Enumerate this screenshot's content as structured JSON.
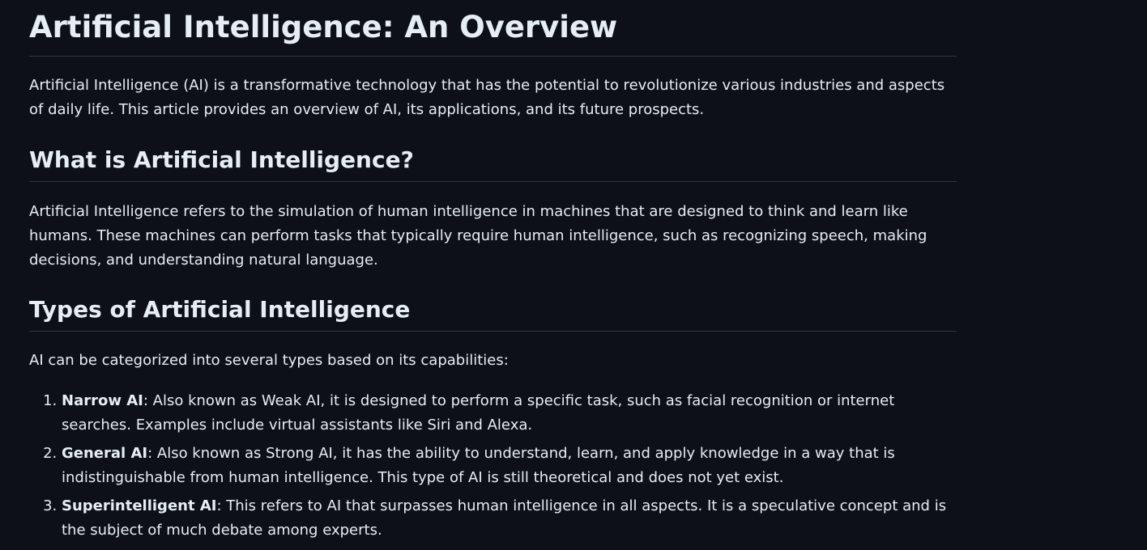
{
  "title": "Artificial Intelligence: An Overview",
  "intro": "Artificial Intelligence (AI) is a transformative technology that has the potential to revolutionize various industries and aspects of daily life. This article provides an overview of AI, its applications, and its future prospects.",
  "sections": [
    {
      "heading": "What is Artificial Intelligence?",
      "body": "Artificial Intelligence refers to the simulation of human intelligence in machines that are designed to think and learn like humans. These machines can perform tasks that typically require human intelligence, such as recognizing speech, making decisions, and understanding natural language."
    },
    {
      "heading": "Types of Artificial Intelligence",
      "body": "AI can be categorized into several types based on its capabilities:",
      "list": [
        {
          "term": "Narrow AI",
          "text": ": Also known as Weak AI, it is designed to perform a specific task, such as facial recognition or internet searches. Examples include virtual assistants like Siri and Alexa."
        },
        {
          "term": "General AI",
          "text": ": Also known as Strong AI, it has the ability to understand, learn, and apply knowledge in a way that is indistinguishable from human intelligence. This type of AI is still theoretical and does not yet exist."
        },
        {
          "term": "Superintelligent AI",
          "text": ": This refers to AI that surpasses human intelligence in all aspects. It is a speculative concept and is the subject of much debate among experts."
        }
      ]
    }
  ],
  "colors": {
    "background": "#0d1117",
    "text": "#e6edf3",
    "divider": "#30363d"
  }
}
